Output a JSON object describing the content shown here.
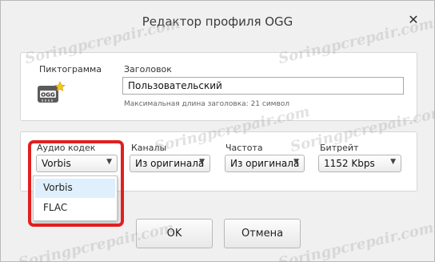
{
  "window": {
    "title": "Редактор профиля OGG",
    "close_glyph": "✕"
  },
  "icon_section": {
    "label": "Пиктограмма",
    "icon_name": "ogg-file-icon",
    "icon_text": "OGG"
  },
  "title_section": {
    "label": "Заголовок",
    "value": "Пользовательский",
    "hint": "Максимальная длина заголовка: 21 символ"
  },
  "audio_codec": {
    "label": "Аудио кодек",
    "value": "Vorbis",
    "options": [
      "Vorbis",
      "FLAC"
    ],
    "highlighted_option": "Vorbis"
  },
  "channels": {
    "label": "Каналы",
    "value": "Из оригинала"
  },
  "frequency": {
    "label": "Частота",
    "value": "Из оригинала"
  },
  "bitrate": {
    "label": "Битрейт",
    "value": "1152 Kbps"
  },
  "buttons": {
    "ok": "OK",
    "cancel": "Отмена"
  },
  "watermark_text": "Soringpcrepair.com",
  "colors": {
    "highlight_border": "#e21f1f",
    "selected_option_bg": "#dfeffb"
  }
}
